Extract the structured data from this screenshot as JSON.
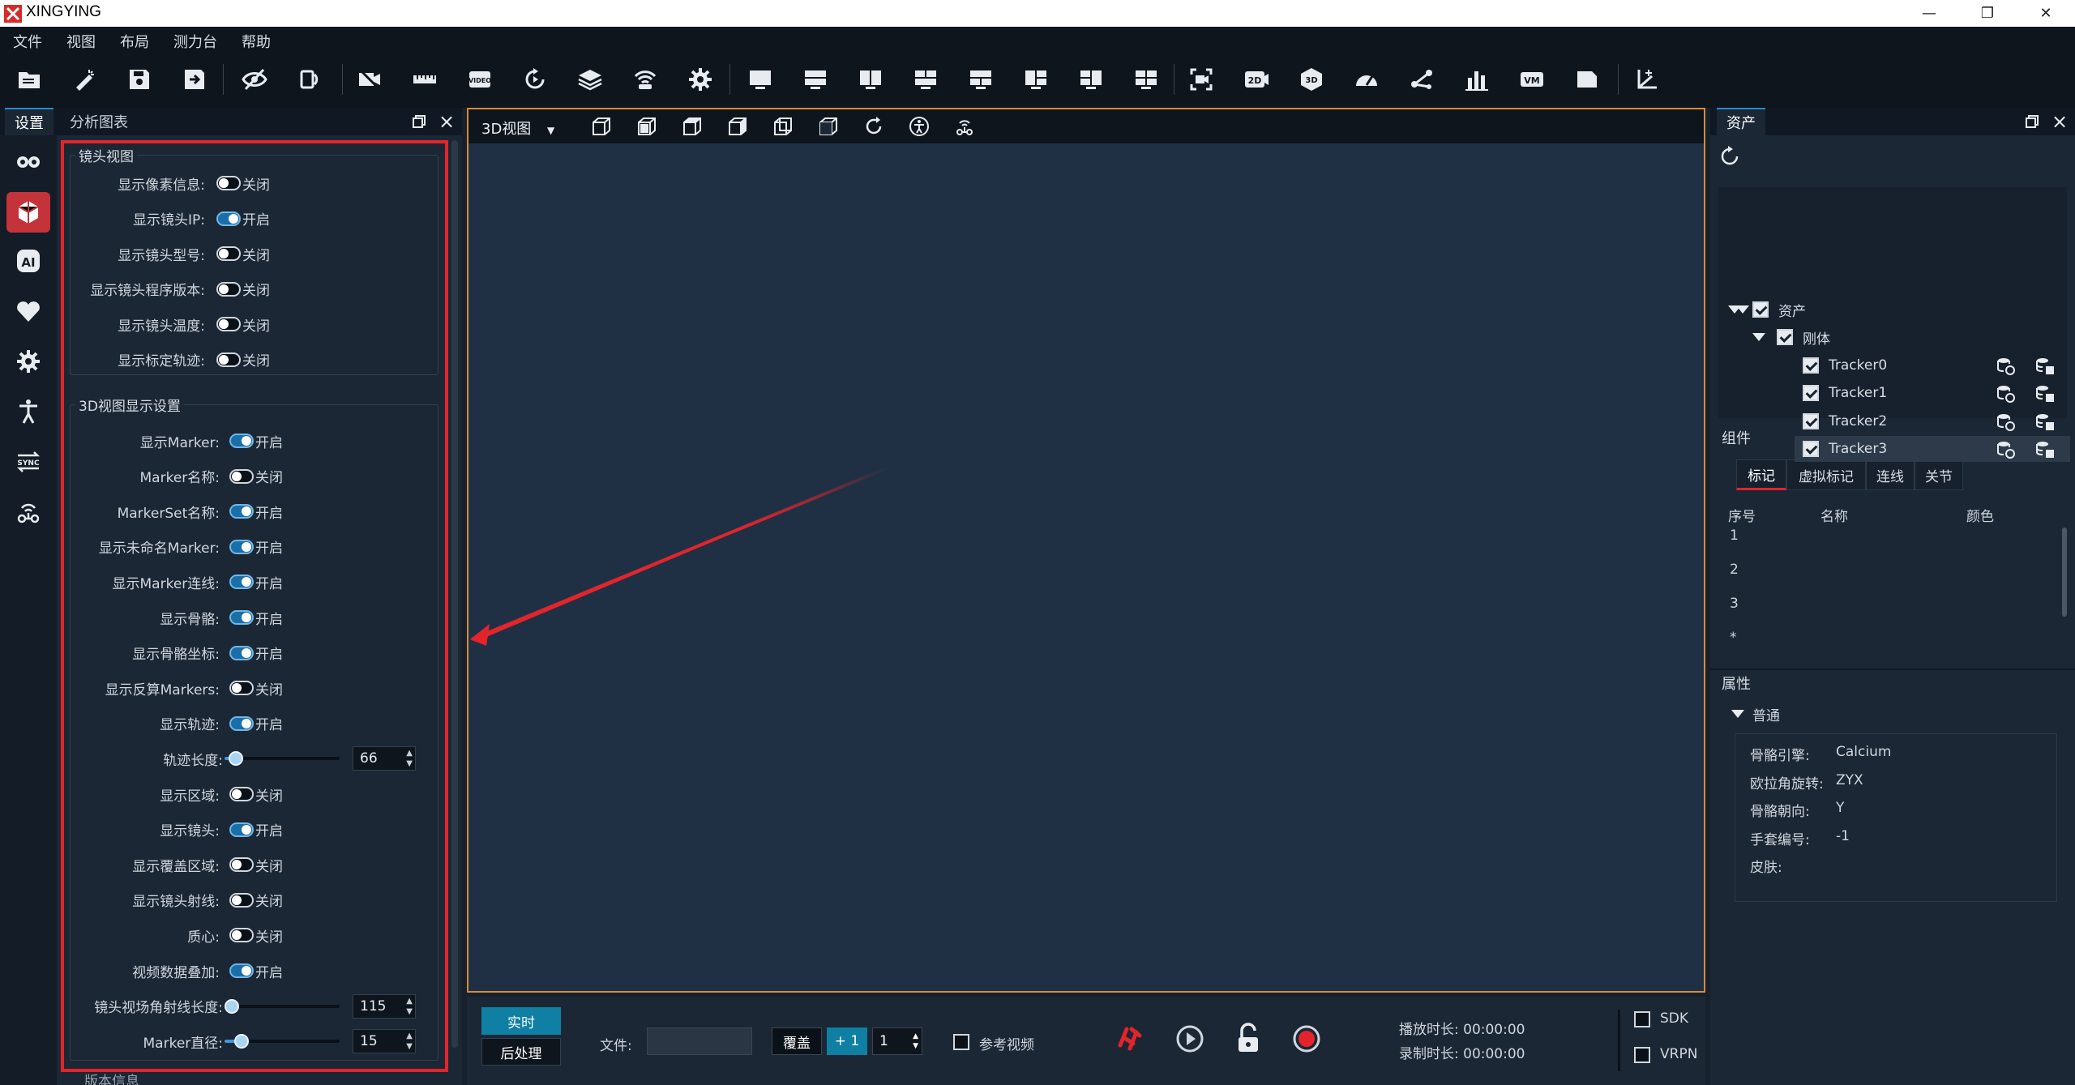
{
  "app": {
    "title": "XINGYING"
  },
  "window_controls": {
    "minimize": "—",
    "restore": "❐",
    "close": "✕"
  },
  "menu": [
    "文件",
    "视图",
    "布局",
    "测力台",
    "帮助"
  ],
  "toolbar": {
    "icons": [
      "open-folder-icon",
      "wand-icon",
      "save-icon",
      "save-as-icon",
      "hide-eye-icon",
      "camera-swap-icon",
      "camera-off-icon",
      "ruler-icon",
      "video-icon",
      "refresh-icon",
      "layers-icon",
      "wifi-router-icon",
      "settings-icon",
      "layout-single-icon",
      "layout-two-rows-icon",
      "layout-two-cols-icon",
      "layout-grid-a-icon",
      "layout-grid-b-icon",
      "layout-grid-c-icon",
      "layout-grid-d-icon",
      "layout-grid-e-icon",
      "capture-icon",
      "2d-icon",
      "3d-icon",
      "gauge-icon",
      "share-icon",
      "bar-chart-icon",
      "vm-icon",
      "document-icon",
      "axis-icon"
    ],
    "badges": {
      "video": "VIDEO",
      "two_d": "2D",
      "three_d": "3D",
      "vm": "VM"
    }
  },
  "left_panel": {
    "tabs": [
      "设置",
      "分析图表"
    ],
    "side_icons": [
      "camera-group-icon",
      "rigid-body-icon",
      "ai-icon",
      "heart-icon",
      "gear-icon",
      "human-figure-icon",
      "sync-icon",
      "router-icon"
    ],
    "ai_label": "AI",
    "sync_label": "SYNC",
    "lens_group": {
      "title": "镜头视图",
      "rows": [
        {
          "label": "显示像素信息:",
          "on": false,
          "state": "关闭"
        },
        {
          "label": "显示镜头IP:",
          "on": true,
          "state": "开启"
        },
        {
          "label": "显示镜头型号:",
          "on": false,
          "state": "关闭"
        },
        {
          "label": "显示镜头程序版本:",
          "on": false,
          "state": "关闭"
        },
        {
          "label": "显示镜头温度:",
          "on": false,
          "state": "关闭"
        },
        {
          "label": "显示标定轨迹:",
          "on": false,
          "state": "关闭"
        }
      ]
    },
    "view3d_group": {
      "title": "3D视图显示设置",
      "rows_a": [
        {
          "label": "显示Marker:",
          "on": true,
          "state": "开启"
        },
        {
          "label": "Marker名称:",
          "on": false,
          "state": "关闭"
        },
        {
          "label": "MarkerSet名称:",
          "on": true,
          "state": "开启"
        },
        {
          "label": "显示未命名Marker:",
          "on": true,
          "state": "开启"
        },
        {
          "label": "显示Marker连线:",
          "on": true,
          "state": "开启"
        },
        {
          "label": "显示骨骼:",
          "on": true,
          "state": "开启"
        },
        {
          "label": "显示骨骼坐标:",
          "on": true,
          "state": "开启"
        },
        {
          "label": "显示反算Markers:",
          "on": false,
          "state": "关闭"
        },
        {
          "label": "显示轨迹:",
          "on": true,
          "state": "开启"
        }
      ],
      "trail_length": {
        "label": "轨迹长度:",
        "value": "66",
        "fraction": 0.1
      },
      "rows_b": [
        {
          "label": "显示区域:",
          "on": false,
          "state": "关闭"
        },
        {
          "label": "显示镜头:",
          "on": true,
          "state": "开启"
        },
        {
          "label": "显示覆盖区域:",
          "on": false,
          "state": "关闭"
        },
        {
          "label": "显示镜头射线:",
          "on": false,
          "state": "关闭"
        },
        {
          "label": "质心:",
          "on": false,
          "state": "关闭"
        },
        {
          "label": "视频数据叠加:",
          "on": true,
          "state": "开启"
        }
      ],
      "fov_ray_length": {
        "label": "镜头视场角射线长度:",
        "value": "115",
        "fraction": 0.0
      },
      "marker_diameter": {
        "label": "Marker直径:",
        "value": "15",
        "fraction": 0.15
      }
    },
    "next_group_title": "版本信息"
  },
  "center": {
    "view_name": "3D视图",
    "view_buttons": [
      "view-front-icon",
      "view-side-icon",
      "view-top-icon",
      "view-back-icon",
      "view-left-icon",
      "view-right-icon",
      "reset-view-icon",
      "human-info-icon",
      "router-view-icon"
    ],
    "bottom": {
      "realtime": "实时",
      "postprocess": "后处理",
      "file_label": "文件:",
      "file_value": "",
      "overwrite": "覆盖",
      "plus_one": "+ 1",
      "take_number": "1",
      "reference_video": "参考视频",
      "playback_label": "播放时长: 00:00:00",
      "record_label": "录制时长: 00:00:00",
      "sdk": "SDK",
      "vrpn": "VRPN",
      "icons": [
        "loop-icon",
        "play-icon",
        "unlock-icon",
        "record-icon"
      ]
    }
  },
  "right_panel": {
    "tab": "资产",
    "tree": {
      "root": "资产",
      "group": "刚体",
      "items": [
        "Tracker0",
        "Tracker1",
        "Tracker2",
        "Tracker3"
      ],
      "selected_index": 3
    },
    "components": {
      "title": "组件",
      "tabs": [
        "标记",
        "虚拟标记",
        "连线",
        "关节"
      ],
      "columns": [
        "序号",
        "名称",
        "颜色"
      ],
      "rows": [
        "1",
        "2",
        "3",
        "*"
      ]
    },
    "properties": {
      "title": "属性",
      "section": "普通",
      "rows": [
        {
          "key": "骨骼引擎:",
          "value": "Calcium"
        },
        {
          "key": "欧拉角旋转:",
          "value": "ZYX"
        },
        {
          "key": "骨骼朝向:",
          "value": "Y"
        },
        {
          "key": "手套编号:",
          "value": "-1"
        },
        {
          "key": "皮肤:",
          "value": ""
        }
      ]
    }
  },
  "colors": {
    "accent": "#2a8acb",
    "highlight_red": "#e3242b",
    "view_border": "#d58b3a",
    "record": "#e3242b"
  }
}
